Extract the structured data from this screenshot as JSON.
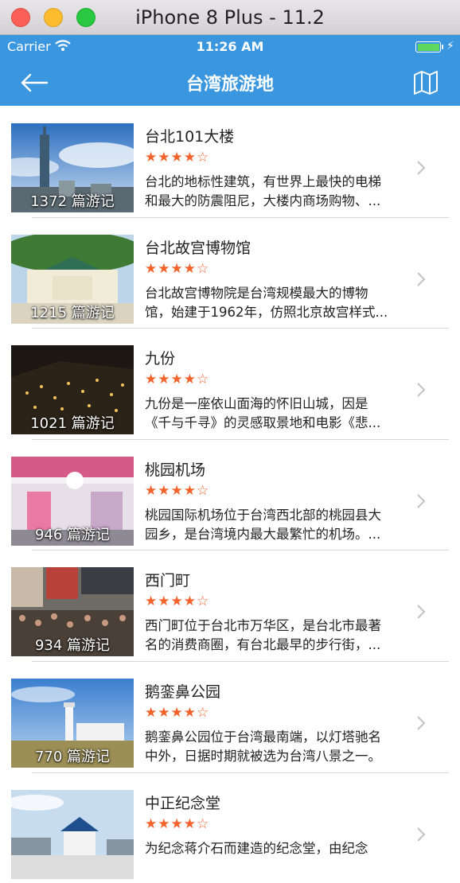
{
  "window": {
    "title": "iPhone 8 Plus - 11.2"
  },
  "status_bar": {
    "carrier": "Carrier",
    "time": "11:26 AM"
  },
  "nav": {
    "title": "台湾旅游地",
    "back_icon": "back-arrow-icon",
    "map_icon": "map-icon"
  },
  "places": [
    {
      "name": "台北101大楼",
      "stars": "★★★★☆",
      "count": "1372 篇游记",
      "desc1": "台北的地标性建筑，有世界上最快的电梯",
      "desc2": "和最大的防震阻尼，大楼内商场购物、..."
    },
    {
      "name": "台北故宫博物馆",
      "stars": "★★★★☆",
      "count": "1215 篇游记",
      "desc1": "台北故宫博物院是台湾规模最大的博物",
      "desc2": "馆，始建于1962年，仿照北京故宫样式..."
    },
    {
      "name": "九份",
      "stars": "★★★★☆",
      "count": "1021 篇游记",
      "desc1": "九份是一座依山面海的怀旧山城，因是",
      "desc2": "《千与千寻》的灵感取景地和电影《悲..."
    },
    {
      "name": "桃园机场",
      "stars": "★★★★☆",
      "count": "946 篇游记",
      "desc1": "桃园国际机场位于台湾西北部的桃园县大",
      "desc2": "园乡，是台湾境内最大最繁忙的机场。..."
    },
    {
      "name": "西门町",
      "stars": "★★★★☆",
      "count": "934 篇游记",
      "desc1": "西门町位于台北市万华区，是台北市最著",
      "desc2": "名的消费商圈，有台北最早的步行街，..."
    },
    {
      "name": "鹅銮鼻公园",
      "stars": "★★★★☆",
      "count": "770 篇游记",
      "desc1": "鹅銮鼻公园位于台湾最南端，以灯塔驰名",
      "desc2": "中外，日据时期就被选为台湾八景之一。"
    },
    {
      "name": "中正纪念堂",
      "stars": "★★★★☆",
      "count": "",
      "desc1": "为纪念蒋介石而建造的纪念堂，由纪念",
      "desc2": ""
    }
  ]
}
